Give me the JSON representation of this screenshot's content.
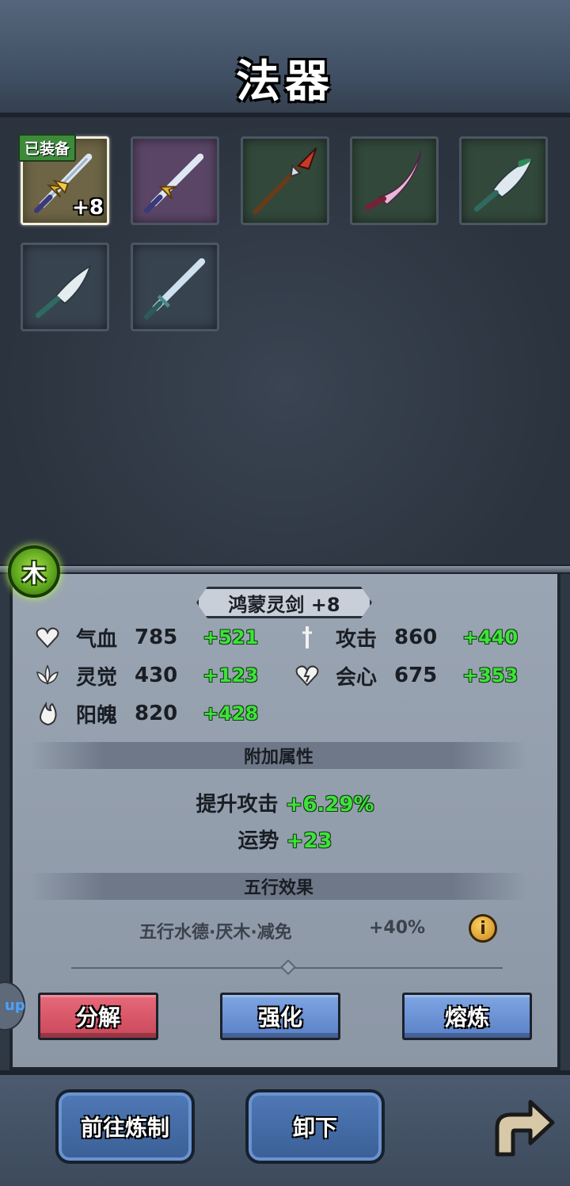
{
  "header": {
    "title": "法器"
  },
  "inventory": {
    "equipped_badge": "已装备",
    "slots": [
      {
        "icon": "golden-sword-icon",
        "equipped": true,
        "level": "+8"
      },
      {
        "icon": "purple-sword-icon"
      },
      {
        "icon": "spear-icon"
      },
      {
        "icon": "curved-blade-icon"
      },
      {
        "icon": "broad-blade-icon"
      },
      {
        "icon": "short-blade-icon"
      },
      {
        "icon": "straight-sword-icon"
      }
    ]
  },
  "detail": {
    "element": "木",
    "item_name": "鸿蒙灵剑 +8",
    "stats": [
      {
        "icon": "heart-icon",
        "name": "气血",
        "value": "785",
        "bonus": "+521"
      },
      {
        "icon": "dagger-icon",
        "name": "攻击",
        "value": "860",
        "bonus": "+440"
      },
      {
        "icon": "lotus-icon",
        "name": "灵觉",
        "value": "430",
        "bonus": "+123"
      },
      {
        "icon": "crit-heart-icon",
        "name": "会心",
        "value": "675",
        "bonus": "+353"
      },
      {
        "icon": "flame-icon",
        "name": "阳魄",
        "value": "820",
        "bonus": "+428"
      }
    ],
    "extra_title": "附加属性",
    "extra": [
      {
        "name": "提升攻击",
        "value": "+6.29%"
      },
      {
        "name": "运势",
        "value": "+23"
      }
    ],
    "wuxing_title": "五行效果",
    "wuxing_text": "五行水德·厌木·减免",
    "wuxing_value": "+40%",
    "info_symbol": "i"
  },
  "actions": {
    "decompose": "分解",
    "enhance": "强化",
    "smelt": "熔炼"
  },
  "nav": {
    "forge": "前往炼制",
    "unequip": "卸下"
  },
  "side_tab": "up",
  "colors": {
    "bonus_green": "#3ee23b",
    "decompose_red": "#e86a7a",
    "button_blue": "#7fa6e4",
    "element_wood": "#5aa31c"
  }
}
